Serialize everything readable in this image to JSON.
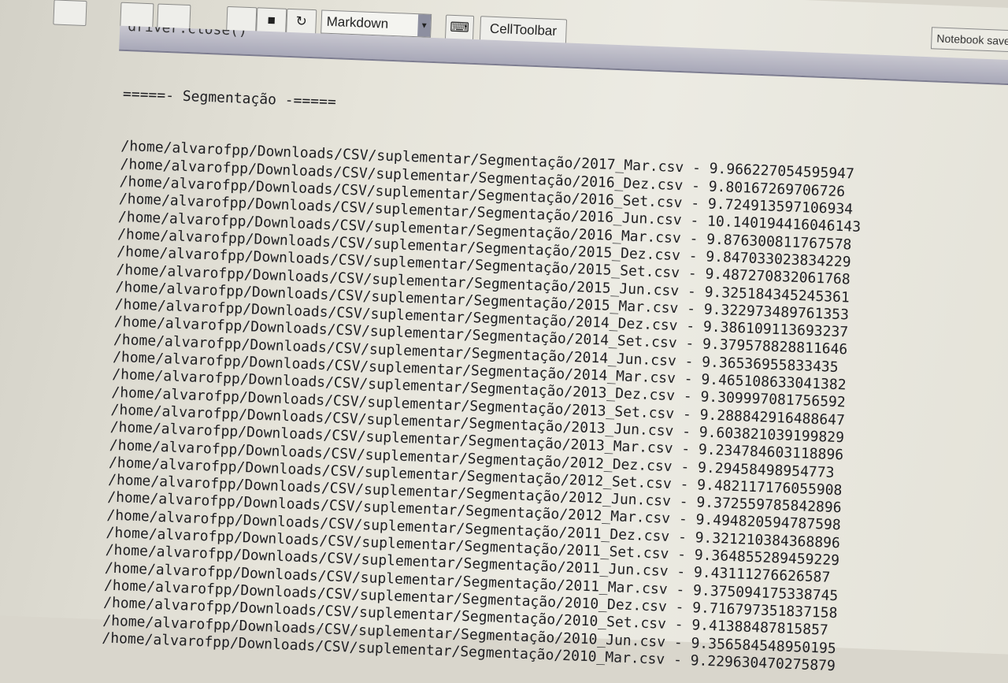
{
  "toolbar": {
    "cell_type": "Markdown",
    "celltoolbar_label": "CellToolbar",
    "notebook_status": "Notebook saved"
  },
  "input_cell": {
    "code": "driver.close()"
  },
  "output": {
    "header": "=====- Segmentação -=====",
    "rows": [
      {
        "path": "/home/alvarofpp/Downloads/CSV/suplementar/Segmentação/2017_Mar.csv",
        "value": "9.966227054595947"
      },
      {
        "path": "/home/alvarofpp/Downloads/CSV/suplementar/Segmentação/2016_Dez.csv",
        "value": "9.80167269706726"
      },
      {
        "path": "/home/alvarofpp/Downloads/CSV/suplementar/Segmentação/2016_Set.csv",
        "value": "9.724913597106934"
      },
      {
        "path": "/home/alvarofpp/Downloads/CSV/suplementar/Segmentação/2016_Jun.csv",
        "value": "10.140194416046143"
      },
      {
        "path": "/home/alvarofpp/Downloads/CSV/suplementar/Segmentação/2016_Mar.csv",
        "value": "9.876300811767578"
      },
      {
        "path": "/home/alvarofpp/Downloads/CSV/suplementar/Segmentação/2015_Dez.csv",
        "value": "9.847033023834229"
      },
      {
        "path": "/home/alvarofpp/Downloads/CSV/suplementar/Segmentação/2015_Set.csv",
        "value": "9.487270832061768"
      },
      {
        "path": "/home/alvarofpp/Downloads/CSV/suplementar/Segmentação/2015_Jun.csv",
        "value": "9.325184345245361"
      },
      {
        "path": "/home/alvarofpp/Downloads/CSV/suplementar/Segmentação/2015_Mar.csv",
        "value": "9.322973489761353"
      },
      {
        "path": "/home/alvarofpp/Downloads/CSV/suplementar/Segmentação/2014_Dez.csv",
        "value": "9.386109113693237"
      },
      {
        "path": "/home/alvarofpp/Downloads/CSV/suplementar/Segmentação/2014_Set.csv",
        "value": "9.379578828811646"
      },
      {
        "path": "/home/alvarofpp/Downloads/CSV/suplementar/Segmentação/2014_Jun.csv",
        "value": "9.36536955833435"
      },
      {
        "path": "/home/alvarofpp/Downloads/CSV/suplementar/Segmentação/2014_Mar.csv",
        "value": "9.465108633041382"
      },
      {
        "path": "/home/alvarofpp/Downloads/CSV/suplementar/Segmentação/2013_Dez.csv",
        "value": "9.309997081756592"
      },
      {
        "path": "/home/alvarofpp/Downloads/CSV/suplementar/Segmentação/2013_Set.csv",
        "value": "9.288842916488647"
      },
      {
        "path": "/home/alvarofpp/Downloads/CSV/suplementar/Segmentação/2013_Jun.csv",
        "value": "9.603821039199829"
      },
      {
        "path": "/home/alvarofpp/Downloads/CSV/suplementar/Segmentação/2013_Mar.csv",
        "value": "9.234784603118896"
      },
      {
        "path": "/home/alvarofpp/Downloads/CSV/suplementar/Segmentação/2012_Dez.csv",
        "value": "9.29458498954773"
      },
      {
        "path": "/home/alvarofpp/Downloads/CSV/suplementar/Segmentação/2012_Set.csv",
        "value": "9.482117176055908"
      },
      {
        "path": "/home/alvarofpp/Downloads/CSV/suplementar/Segmentação/2012_Jun.csv",
        "value": "9.372559785842896"
      },
      {
        "path": "/home/alvarofpp/Downloads/CSV/suplementar/Segmentação/2012_Mar.csv",
        "value": "9.494820594787598"
      },
      {
        "path": "/home/alvarofpp/Downloads/CSV/suplementar/Segmentação/2011_Dez.csv",
        "value": "9.321210384368896"
      },
      {
        "path": "/home/alvarofpp/Downloads/CSV/suplementar/Segmentação/2011_Set.csv",
        "value": "9.364855289459229"
      },
      {
        "path": "/home/alvarofpp/Downloads/CSV/suplementar/Segmentação/2011_Jun.csv",
        "value": "9.43111276626587"
      },
      {
        "path": "/home/alvarofpp/Downloads/CSV/suplementar/Segmentação/2011_Mar.csv",
        "value": "9.375094175338745"
      },
      {
        "path": "/home/alvarofpp/Downloads/CSV/suplementar/Segmentação/2010_Dez.csv",
        "value": "9.716797351837158"
      },
      {
        "path": "/home/alvarofpp/Downloads/CSV/suplementar/Segmentação/2010_Set.csv",
        "value": "9.41388487815857"
      },
      {
        "path": "/home/alvarofpp/Downloads/CSV/suplementar/Segmentação/2010_Jun.csv",
        "value": "9.356584548950195"
      },
      {
        "path": "/home/alvarofpp/Downloads/CSV/suplementar/Segmentação/2010_Mar.csv",
        "value": "9.229630470275879"
      }
    ]
  }
}
